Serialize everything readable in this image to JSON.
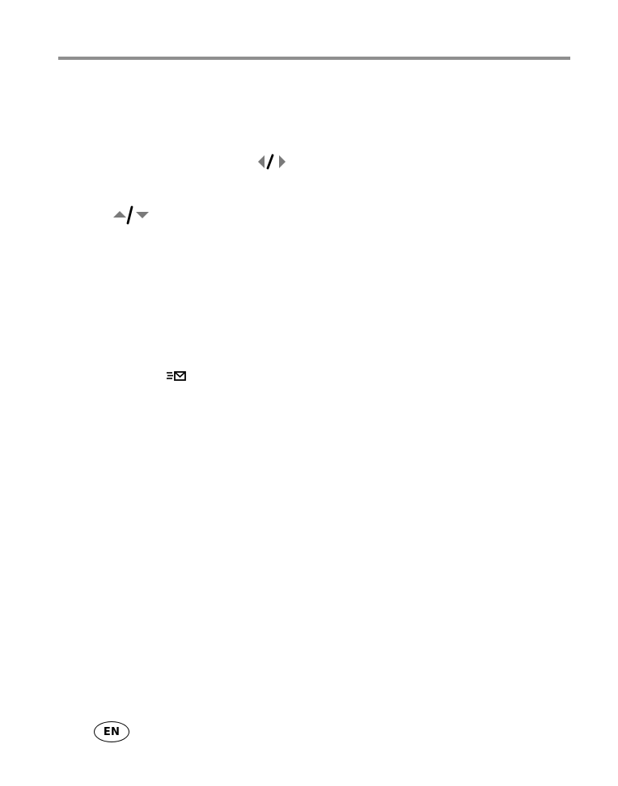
{
  "document": {
    "header_rule_color": "#8f8f8f",
    "icons": {
      "navigation_left_right": "left-right-arrows-icon",
      "navigation_up_down": "up-down-arrows-icon",
      "share": "share-envelope-icon"
    },
    "language_badge": {
      "text": "EN"
    }
  }
}
